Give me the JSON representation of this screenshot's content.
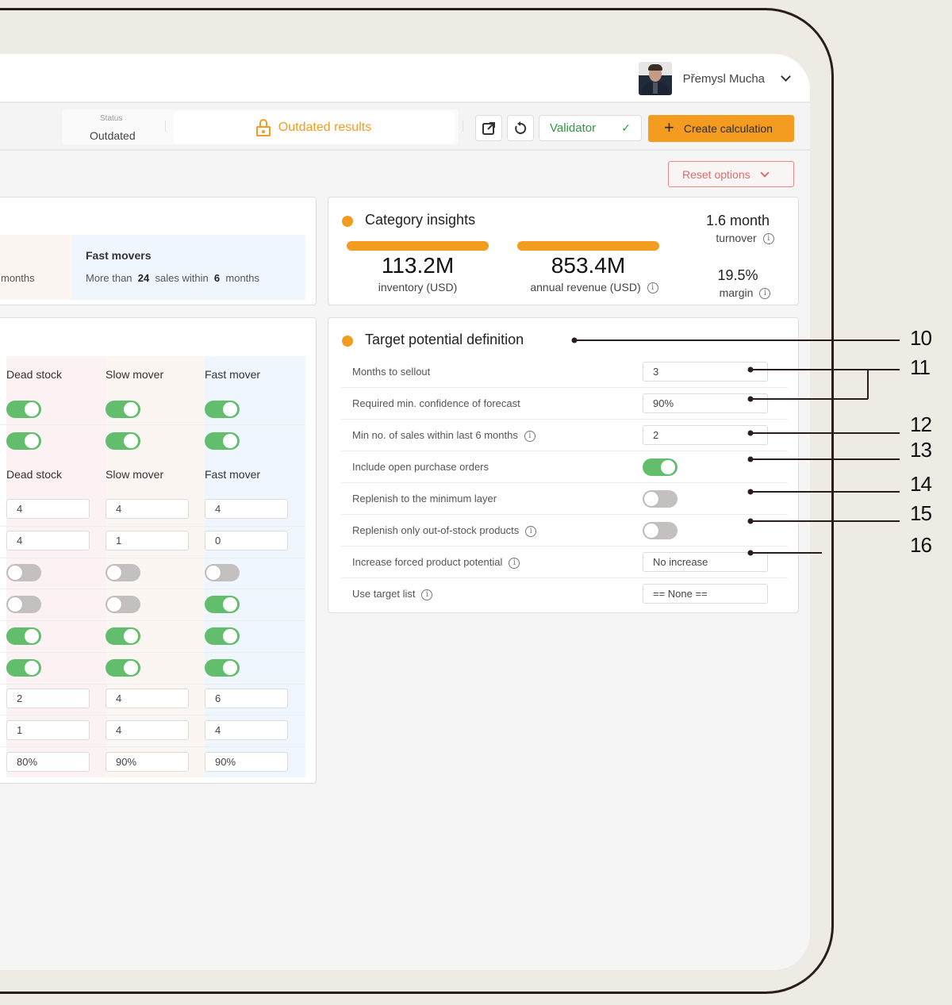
{
  "header": {
    "user_name": "Přemysl Mucha",
    "avatar": "user-photo"
  },
  "toolbar": {
    "status_label": "Status",
    "status_value": "Outdated",
    "outdated_text": "Outdated results",
    "external_link_icon": "external-link-icon",
    "refresh_icon": "refresh-icon",
    "validator_label": "Validator",
    "validator_icon": "check-icon",
    "create_label": "Create calculation",
    "create_icon": "plus-icon",
    "reset_label": "Reset options"
  },
  "movers": {
    "slow_tail": "months",
    "fast_title": "Fast movers",
    "fast_desc_prefix": "More than",
    "fast_sales": "24",
    "fast_desc_mid": "sales within",
    "fast_months": "6",
    "fast_desc_suffix": "months"
  },
  "settings_grid": {
    "columns": [
      "Dead stock",
      "Slow mover",
      "Fast mover"
    ],
    "toggle_rows_top": [
      [
        true,
        true,
        true
      ],
      [
        true,
        true,
        true
      ]
    ],
    "columns_second": [
      "Dead stock",
      "Slow mover",
      "Fast mover"
    ],
    "value_rows_a": [
      [
        "4",
        "4",
        "4"
      ],
      [
        "4",
        "1",
        "0"
      ]
    ],
    "toggle_rows_mid": [
      [
        false,
        false,
        false
      ],
      [
        false,
        false,
        true
      ],
      [
        true,
        true,
        true
      ],
      [
        true,
        true,
        true
      ]
    ],
    "value_rows_b": [
      [
        "2",
        "4",
        "6"
      ],
      [
        "1",
        "4",
        "4"
      ],
      [
        "80%",
        "90%",
        "90%"
      ]
    ]
  },
  "category_insights": {
    "title": "Category insights",
    "inventory_value": "113.2M",
    "inventory_label": "inventory (USD)",
    "revenue_value": "853.4M",
    "revenue_label": "annual revenue (USD)",
    "turnover_value": "1.6 month",
    "turnover_label": "turnover",
    "margin_value": "19.5%",
    "margin_label": "margin",
    "accent_color": "#f39c1f"
  },
  "target_potential": {
    "title": "Target potential definition",
    "rows": [
      {
        "label": "Months to sellout",
        "type": "input",
        "value": "3",
        "info": false
      },
      {
        "label": "Required min. confidence of forecast",
        "type": "input",
        "value": "90%",
        "info": false
      },
      {
        "label": "Min no. of sales within last 6 months",
        "type": "input",
        "value": "2",
        "info": true
      },
      {
        "label": "Include open purchase orders",
        "type": "toggle",
        "value": true,
        "info": false
      },
      {
        "label": "Replenish to the minimum layer",
        "type": "toggle",
        "value": false,
        "info": false
      },
      {
        "label": "Replenish only out-of-stock products",
        "type": "toggle",
        "value": false,
        "info": true
      },
      {
        "label": "Increase forced product potential",
        "type": "select",
        "value": "No increase",
        "info": true
      },
      {
        "label": "Use target list",
        "type": "select",
        "value": "== None ==",
        "info": true
      }
    ]
  },
  "annotations": [
    "10",
    "11",
    "12",
    "13",
    "14",
    "15",
    "16"
  ],
  "colors": {
    "accent": "#f39c1f",
    "toggle_on": "#62bd6d",
    "validator_green": "#2e9a3d",
    "reset_red": "#e06b6b"
  }
}
